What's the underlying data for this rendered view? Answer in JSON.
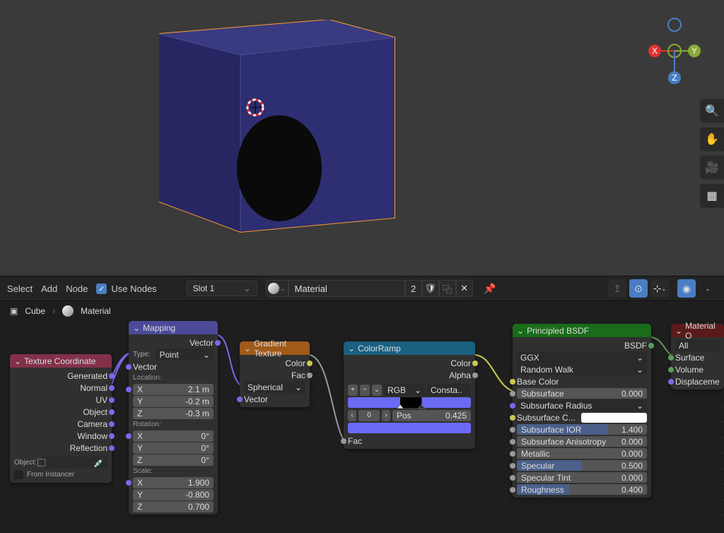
{
  "header": {
    "select": "Select",
    "add": "Add",
    "node": "Node",
    "use_nodes": "Use Nodes",
    "slot": "Slot 1",
    "material": "Material",
    "users": "2"
  },
  "breadcrumb": {
    "object": "Cube",
    "material": "Material"
  },
  "nodes": {
    "tex_coord": {
      "title": "Texture Coordinate",
      "outputs": [
        "Generated",
        "Normal",
        "UV",
        "Object",
        "Camera",
        "Window",
        "Reflection"
      ],
      "object_label": "Object:",
      "from_instancer": "From Instancer"
    },
    "mapping": {
      "title": "Mapping",
      "vector_out": "Vector",
      "type_label": "Type:",
      "type_value": "Point",
      "vector_in": "Vector",
      "location": "Location:",
      "loc": {
        "x": "2.1 m",
        "y": "-0.2 m",
        "z": "-0.3 m"
      },
      "rotation": "Rotation:",
      "rot": {
        "x": "0°",
        "y": "0°",
        "z": "0°"
      },
      "scale": "Scale:",
      "scl": {
        "x": "1.900",
        "y": "-0.800",
        "z": "0.700"
      }
    },
    "gradient": {
      "title": "Gradient Texture",
      "color": "Color",
      "fac": "Fac",
      "type": "Spherical",
      "vector": "Vector"
    },
    "color_ramp": {
      "title": "ColorRamp",
      "color": "Color",
      "alpha": "Alpha",
      "mode": "RGB",
      "interp": "Consta..",
      "index": "0",
      "pos_label": "Pos",
      "pos_value": "0.425",
      "fac": "Fac"
    },
    "bsdf": {
      "title": "Principled BSDF",
      "bsdf_out": "BSDF",
      "dist": "GGX",
      "sss": "Random Walk",
      "base_color": "Base Color",
      "rows": [
        {
          "label": "Subsurface",
          "value": "0.000",
          "slider": false
        },
        {
          "label": "Subsurface Radius",
          "value": "",
          "dropdown": true
        },
        {
          "label": "Subsurface C...",
          "value": "",
          "color": "#fff"
        },
        {
          "label": "Subsurface IOR",
          "value": "1.400",
          "slider": true
        },
        {
          "label": "Subsurface Anisotropy",
          "value": "0.000",
          "slider": false
        },
        {
          "label": "Metallic",
          "value": "0.000",
          "slider": false
        },
        {
          "label": "Specular",
          "value": "0.500",
          "slider": true
        },
        {
          "label": "Specular Tint",
          "value": "0.000",
          "slider": false
        },
        {
          "label": "Roughness",
          "value": "0.400",
          "slider": true
        }
      ]
    },
    "output": {
      "title": "Material O",
      "target": "All",
      "surface": "Surface",
      "volume": "Volume",
      "displacement": "Displaceme"
    }
  }
}
